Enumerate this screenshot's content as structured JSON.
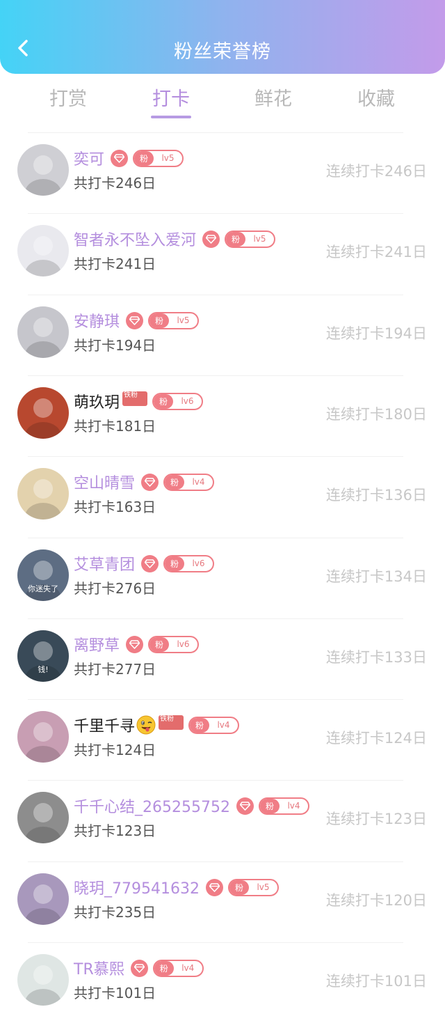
{
  "header": {
    "title": "粉丝荣誉榜",
    "back_icon": "chevron-left-icon"
  },
  "tabs": [
    {
      "label": "打赏",
      "active": false
    },
    {
      "label": "打卡",
      "active": true
    },
    {
      "label": "鲜花",
      "active": false
    },
    {
      "label": "收藏",
      "active": false
    }
  ],
  "colors": {
    "accent": "#b48ede",
    "badge": "#f07d86",
    "header_start": "#44d3f6",
    "header_end": "#c39bea",
    "muted": "#c7c7c7"
  },
  "rows": [
    {
      "name": "奕可",
      "vip": true,
      "fan_label": "粉",
      "level": "lv5",
      "total": "共打卡246日",
      "streak": "连续打卡246日",
      "avatar_color": "#cfcfd4"
    },
    {
      "name": "智者永不坠入爱河",
      "vip": true,
      "fan_label": "粉",
      "level": "lv5",
      "total": "共打卡241日",
      "streak": "连续打卡241日",
      "avatar_color": "#e9e9ee"
    },
    {
      "name": "安静琪",
      "vip": true,
      "fan_label": "粉",
      "level": "lv5",
      "total": "共打卡194日",
      "streak": "连续打卡194日",
      "avatar_color": "#c6c6cc"
    },
    {
      "name": "萌玖玥",
      "vip": false,
      "iron_fan": "铁粉",
      "fan_label": "粉",
      "level": "lv6",
      "total": "共打卡181日",
      "streak": "连续打卡180日",
      "avatar_color": "#b8482f"
    },
    {
      "name": "空山晴雪",
      "vip": true,
      "fan_label": "粉",
      "level": "lv4",
      "total": "共打卡163日",
      "streak": "连续打卡136日",
      "avatar_color": "#e3d2ad"
    },
    {
      "name": "艾草青团",
      "vip": true,
      "fan_label": "粉",
      "level": "lv6",
      "total": "共打卡276日",
      "streak": "连续打卡134日",
      "avatar_color": "#5d6d83",
      "avatar_text": "你迷失了"
    },
    {
      "name": "离野草",
      "vip": true,
      "fan_label": "粉",
      "level": "lv6",
      "total": "共打卡277日",
      "streak": "连续打卡133日",
      "avatar_color": "#394a58",
      "avatar_text": "钱!"
    },
    {
      "name": "千里千寻",
      "vip": false,
      "emoji": "winking-tongue-emoji",
      "iron_fan": "铁粉",
      "fan_label": "粉",
      "level": "lv4",
      "total": "共打卡124日",
      "streak": "连续打卡124日",
      "avatar_color": "#c89eb3"
    },
    {
      "name": "千千心结_265255752",
      "vip": true,
      "fan_label": "粉",
      "level": "lv4",
      "total": "共打卡123日",
      "streak": "连续打卡123日",
      "avatar_color": "#8d8d8d"
    },
    {
      "name": "晓玥_779541632",
      "vip": true,
      "fan_label": "粉",
      "level": "lv5",
      "total": "共打卡235日",
      "streak": "连续打卡120日",
      "avatar_color": "#a898bc"
    },
    {
      "name": "TR慕熙",
      "vip": true,
      "fan_label": "粉",
      "level": "lv4",
      "total": "共打卡101日",
      "streak": "连续打卡101日",
      "avatar_color": "#dfe6e4"
    }
  ]
}
